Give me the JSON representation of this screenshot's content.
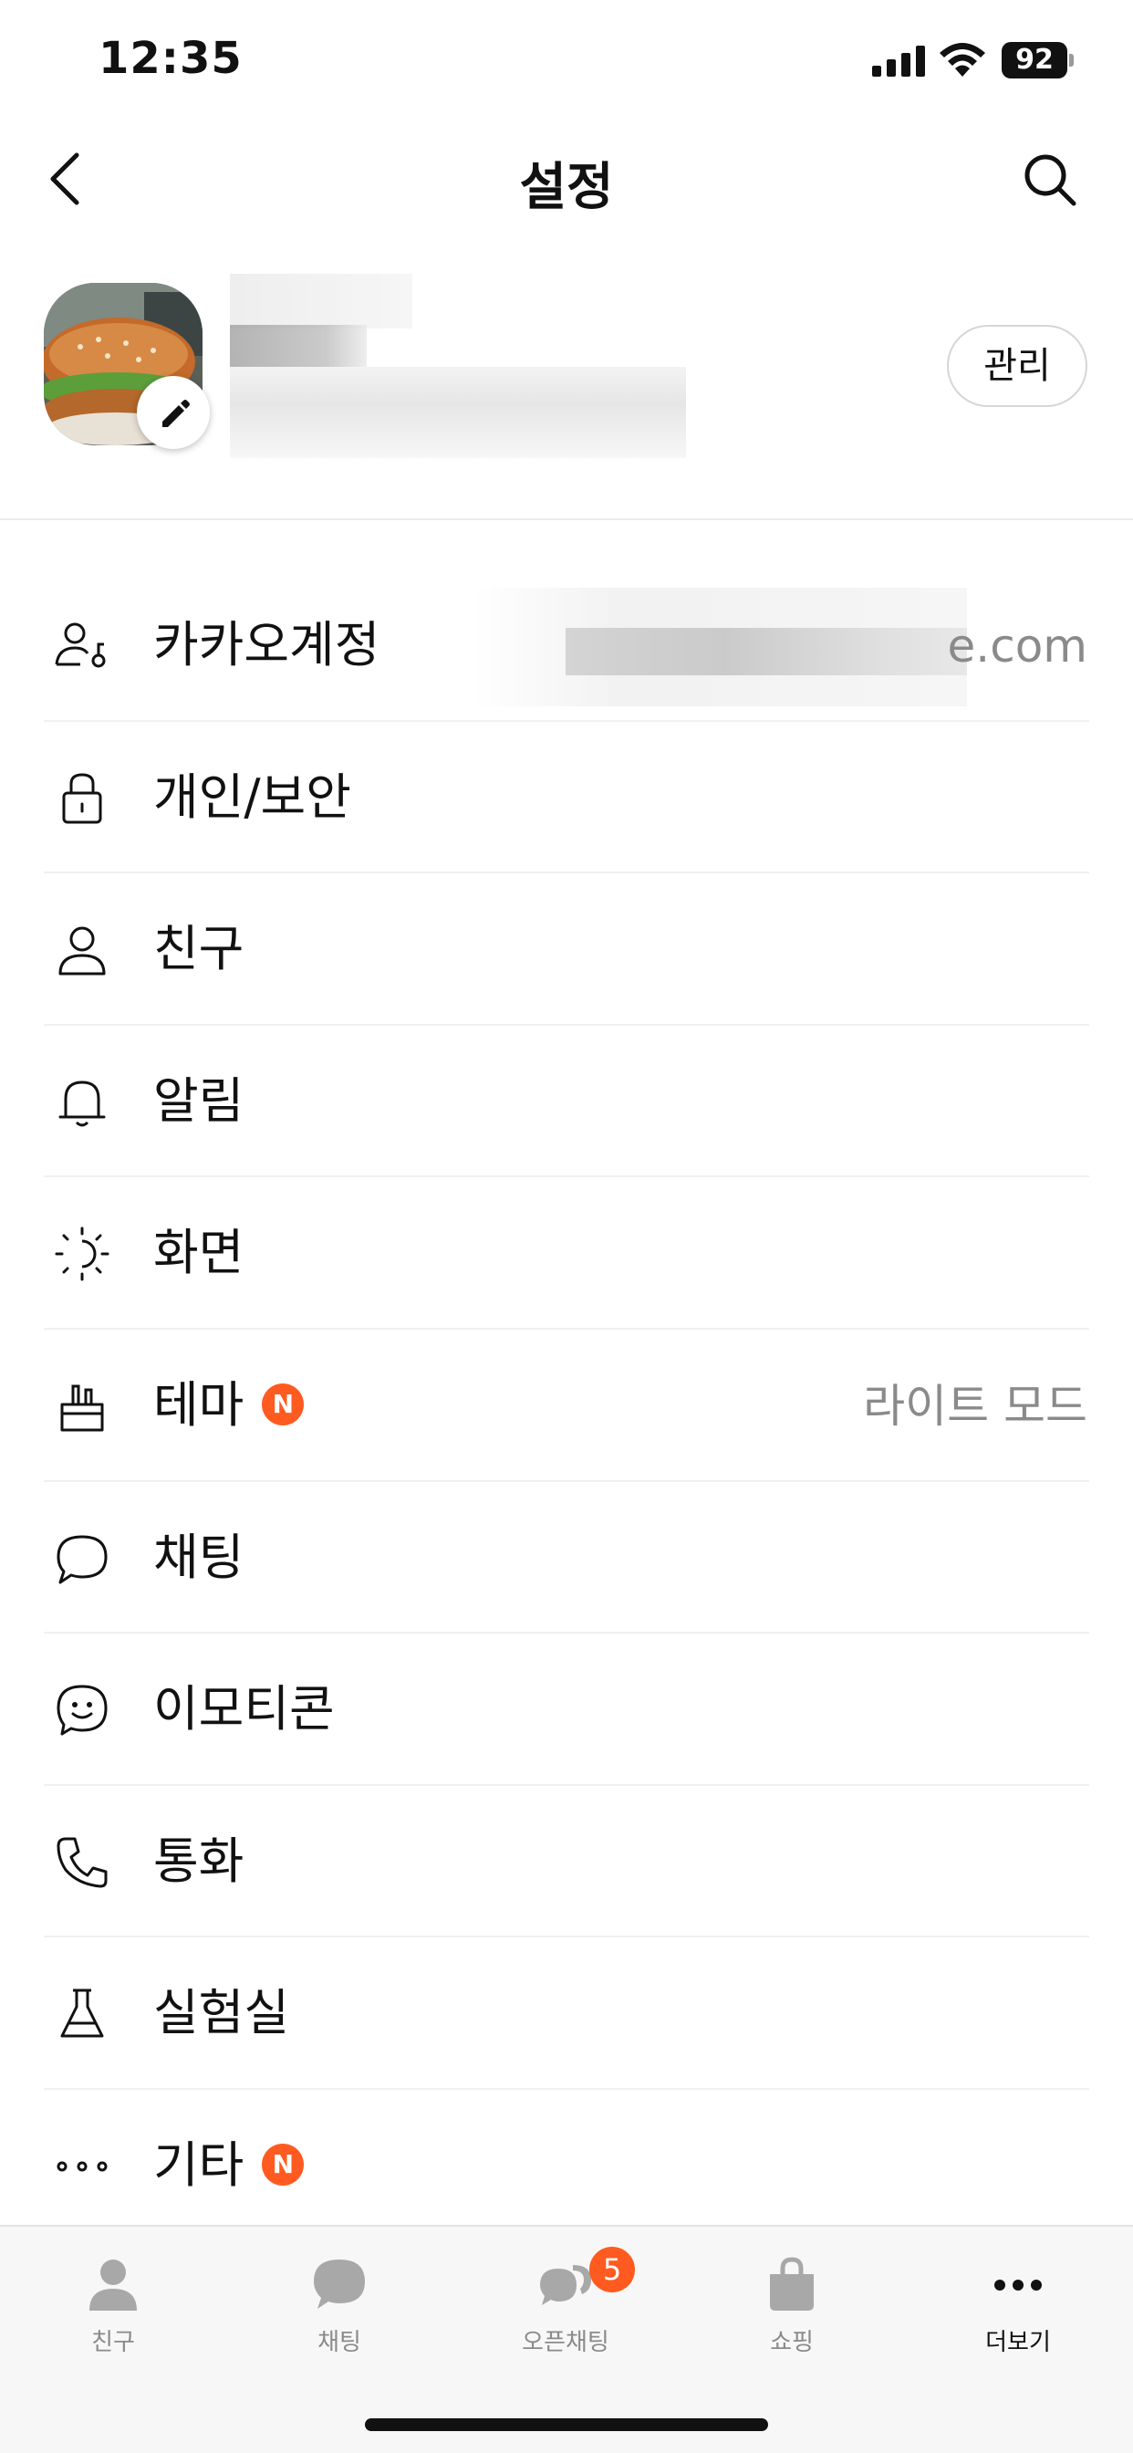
{
  "status_bar": {
    "time": "12:35",
    "battery": "92",
    "icons": [
      "signal-icon",
      "wifi-icon",
      "battery-icon"
    ]
  },
  "header": {
    "title": "설정",
    "back_icon": "chevron-left-icon",
    "search_icon": "search-icon"
  },
  "profile": {
    "manage_label": "관리",
    "edit_icon": "pencil-icon"
  },
  "menu": {
    "items": [
      {
        "label": "카카오계정",
        "value": "e.com",
        "icon": "account-key-icon"
      },
      {
        "label": "개인/보안",
        "value": "",
        "icon": "lock-icon"
      },
      {
        "label": "친구",
        "value": "",
        "icon": "person-icon"
      },
      {
        "label": "알림",
        "value": "",
        "icon": "bell-icon"
      },
      {
        "label": "화면",
        "value": "",
        "icon": "brightness-icon"
      },
      {
        "label": "테마",
        "value": "라이트 모드",
        "icon": "paintbrush-icon",
        "badge": "N"
      },
      {
        "label": "채팅",
        "value": "",
        "icon": "chat-bubble-icon"
      },
      {
        "label": "이모티콘",
        "value": "",
        "icon": "emoticon-icon"
      },
      {
        "label": "통화",
        "value": "",
        "icon": "phone-icon"
      },
      {
        "label": "실험실",
        "value": "",
        "icon": "flask-icon"
      },
      {
        "label": "기타",
        "value": "",
        "icon": "more-dots-icon",
        "badge": "N"
      }
    ]
  },
  "tab_bar": {
    "tabs": [
      {
        "label": "친구",
        "icon": "person-filled-icon"
      },
      {
        "label": "채팅",
        "icon": "chat-filled-icon"
      },
      {
        "label": "오픈채팅",
        "icon": "open-chat-icon",
        "badge": "5"
      },
      {
        "label": "쇼핑",
        "icon": "shopping-bag-icon"
      },
      {
        "label": "더보기",
        "icon": "more-horizontal-icon"
      }
    ],
    "active": "더보기"
  },
  "colors": {
    "accent": "#ff5a1f",
    "text": "#111111",
    "secondary_text": "#8a8a8a",
    "tab_bar_bg": "#f7f7f7"
  }
}
